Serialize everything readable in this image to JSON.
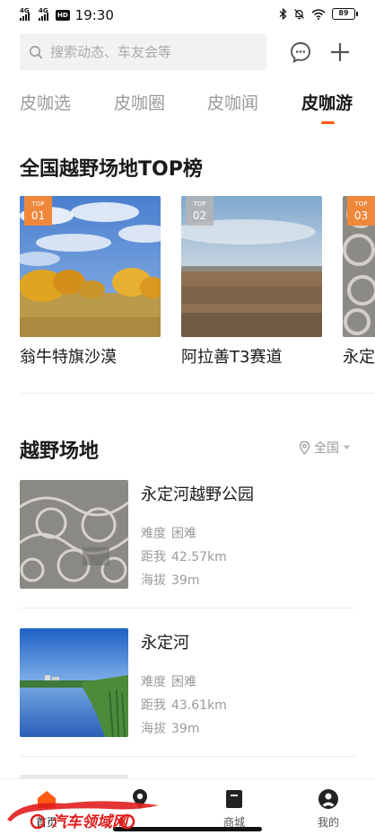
{
  "status_bar": {
    "network_1": "4G",
    "network_2": "4G",
    "hd_label": "HD",
    "time": "19:30",
    "battery": "89"
  },
  "search": {
    "placeholder": "搜索动态、车友会等"
  },
  "icons": {
    "search": "search-icon",
    "message": "message-icon",
    "add": "plus-icon",
    "location": "location-pin-icon",
    "dropdown": "caret-down-icon"
  },
  "tabs": [
    {
      "label": "皮咖选",
      "active": false
    },
    {
      "label": "皮咖圈",
      "active": false
    },
    {
      "label": "皮咖闻",
      "active": false
    },
    {
      "label": "皮咖游",
      "active": true
    }
  ],
  "top_section": {
    "title": "全国越野场地TOP榜",
    "cards": [
      {
        "badge_top": "TOP",
        "rank": "01",
        "name": "翁牛特旗沙漠"
      },
      {
        "badge_top": "TOP",
        "rank": "02",
        "name": "阿拉善T3赛道"
      },
      {
        "badge_top": "TOP",
        "rank": "03",
        "name": "永定河越野公园"
      }
    ]
  },
  "offroad_section": {
    "title": "越野场地",
    "location_filter": "全国",
    "venues": [
      {
        "name": "永定河越野公园",
        "difficulty_label": "难度",
        "difficulty": "困难",
        "distance_label": "距我",
        "distance": "42.57km",
        "altitude_label": "海拔",
        "altitude": "39m"
      },
      {
        "name": "永定河",
        "difficulty_label": "难度",
        "difficulty": "困难",
        "distance_label": "距我",
        "distance": "43.61km",
        "altitude_label": "海拔",
        "altitude": "39m"
      }
    ]
  },
  "bottom_nav": [
    {
      "label": "首页",
      "icon": "home-icon",
      "active": true
    },
    {
      "label": "",
      "icon": "location-pin-icon",
      "active": false
    },
    {
      "label": "商城",
      "icon": "shop-icon",
      "active": false
    },
    {
      "label": "我的",
      "icon": "profile-icon",
      "active": false
    }
  ],
  "watermark": {
    "text": "汽车领域网"
  },
  "colors": {
    "accent": "#ff5a14",
    "badge_orange": "#f0883c",
    "text_primary": "#1a1a1a",
    "text_secondary": "#9a9a9a",
    "search_bg": "#f2f2f2"
  }
}
